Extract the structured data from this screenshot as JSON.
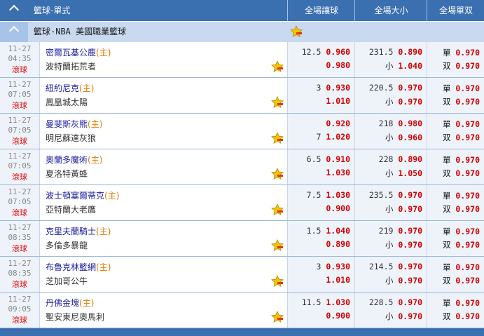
{
  "header": {
    "title": "籃球-單式",
    "col_handicap": "全場讓球",
    "col_total": "全場大小",
    "col_oddeven": "全場單双"
  },
  "league": {
    "name": "籃球-NBA 美國職業籃球"
  },
  "matches": [
    {
      "date": "11-27",
      "time": "04:35",
      "live": "滾球",
      "home": "密爾瓦基公鹿",
      "home_tag": "(主)",
      "away": "波特蘭拓荒者",
      "hdp_line_top": "12.5",
      "hdp_odds_top": "0.960",
      "hdp_line_bottom": "",
      "hdp_odds_bottom": "0.980",
      "ou_line_top": "231.5",
      "ou_odds_top": "0.890",
      "ou_label_bottom": "小",
      "ou_odds_bottom": "1.040",
      "odd_label": "單",
      "odd_odds": "0.970",
      "even_label": "双",
      "even_odds": "0.970"
    },
    {
      "date": "11-27",
      "time": "07:05",
      "live": "滾球",
      "home": "紐約尼克",
      "home_tag": "(主)",
      "away": "鳳凰城太陽",
      "hdp_line_top": "3",
      "hdp_odds_top": "0.930",
      "hdp_line_bottom": "",
      "hdp_odds_bottom": "1.010",
      "ou_line_top": "220.5",
      "ou_odds_top": "0.970",
      "ou_label_bottom": "小",
      "ou_odds_bottom": "0.970",
      "odd_label": "單",
      "odd_odds": "0.970",
      "even_label": "双",
      "even_odds": "0.970"
    },
    {
      "date": "11-27",
      "time": "07:05",
      "live": "滾球",
      "home": "曼斐斯灰熊",
      "home_tag": "(主)",
      "away": "明尼蘇達灰狼",
      "hdp_line_top": "",
      "hdp_odds_top": "0.920",
      "hdp_line_bottom": "7",
      "hdp_odds_bottom": "1.020",
      "ou_line_top": "218",
      "ou_odds_top": "0.980",
      "ou_label_bottom": "小",
      "ou_odds_bottom": "0.960",
      "odd_label": "單",
      "odd_odds": "0.970",
      "even_label": "双",
      "even_odds": "0.970"
    },
    {
      "date": "11-27",
      "time": "07:05",
      "live": "滾球",
      "home": "奧蘭多魔術",
      "home_tag": "(主)",
      "away": "夏洛特黃蜂",
      "hdp_line_top": "6.5",
      "hdp_odds_top": "0.910",
      "hdp_line_bottom": "",
      "hdp_odds_bottom": "1.030",
      "ou_line_top": "228",
      "ou_odds_top": "0.890",
      "ou_label_bottom": "小",
      "ou_odds_bottom": "1.050",
      "odd_label": "單",
      "odd_odds": "0.970",
      "even_label": "双",
      "even_odds": "0.970"
    },
    {
      "date": "11-27",
      "time": "07:05",
      "live": "滾球",
      "home": "波士頓塞爾蒂克",
      "home_tag": "(主)",
      "away": "亞特蘭大老鷹",
      "hdp_line_top": "7.5",
      "hdp_odds_top": "1.030",
      "hdp_line_bottom": "",
      "hdp_odds_bottom": "0.900",
      "ou_line_top": "235.5",
      "ou_odds_top": "0.970",
      "ou_label_bottom": "小",
      "ou_odds_bottom": "0.970",
      "odd_label": "單",
      "odd_odds": "0.970",
      "even_label": "双",
      "even_odds": "0.970"
    },
    {
      "date": "11-27",
      "time": "08:35",
      "live": "滾球",
      "home": "克里夫蘭騎士",
      "home_tag": "(主)",
      "away": "多倫多暴龍",
      "hdp_line_top": "1.5",
      "hdp_odds_top": "1.040",
      "hdp_line_bottom": "",
      "hdp_odds_bottom": "0.890",
      "ou_line_top": "219",
      "ou_odds_top": "0.970",
      "ou_label_bottom": "小",
      "ou_odds_bottom": "0.970",
      "odd_label": "單",
      "odd_odds": "0.970",
      "even_label": "双",
      "even_odds": "0.970"
    },
    {
      "date": "11-27",
      "time": "08:35",
      "live": "滾球",
      "home": "布魯克林籃網",
      "home_tag": "(主)",
      "away": "芝加哥公牛",
      "hdp_line_top": "3",
      "hdp_odds_top": "0.930",
      "hdp_line_bottom": "",
      "hdp_odds_bottom": "1.010",
      "ou_line_top": "214.5",
      "ou_odds_top": "0.970",
      "ou_label_bottom": "小",
      "ou_odds_bottom": "0.970",
      "odd_label": "單",
      "odd_odds": "0.970",
      "even_label": "双",
      "even_odds": "0.970"
    },
    {
      "date": "11-27",
      "time": "09:05",
      "live": "滾球",
      "home": "丹佛金塊",
      "home_tag": "(主)",
      "away": "聖安東尼奧馬刺",
      "hdp_line_top": "11.5",
      "hdp_odds_top": "1.030",
      "hdp_line_bottom": "",
      "hdp_odds_bottom": "0.900",
      "ou_line_top": "228.5",
      "ou_odds_top": "0.970",
      "ou_label_bottom": "小",
      "ou_odds_bottom": "0.970",
      "odd_label": "單",
      "odd_odds": "0.970",
      "even_label": "双",
      "even_odds": "0.970"
    }
  ]
}
